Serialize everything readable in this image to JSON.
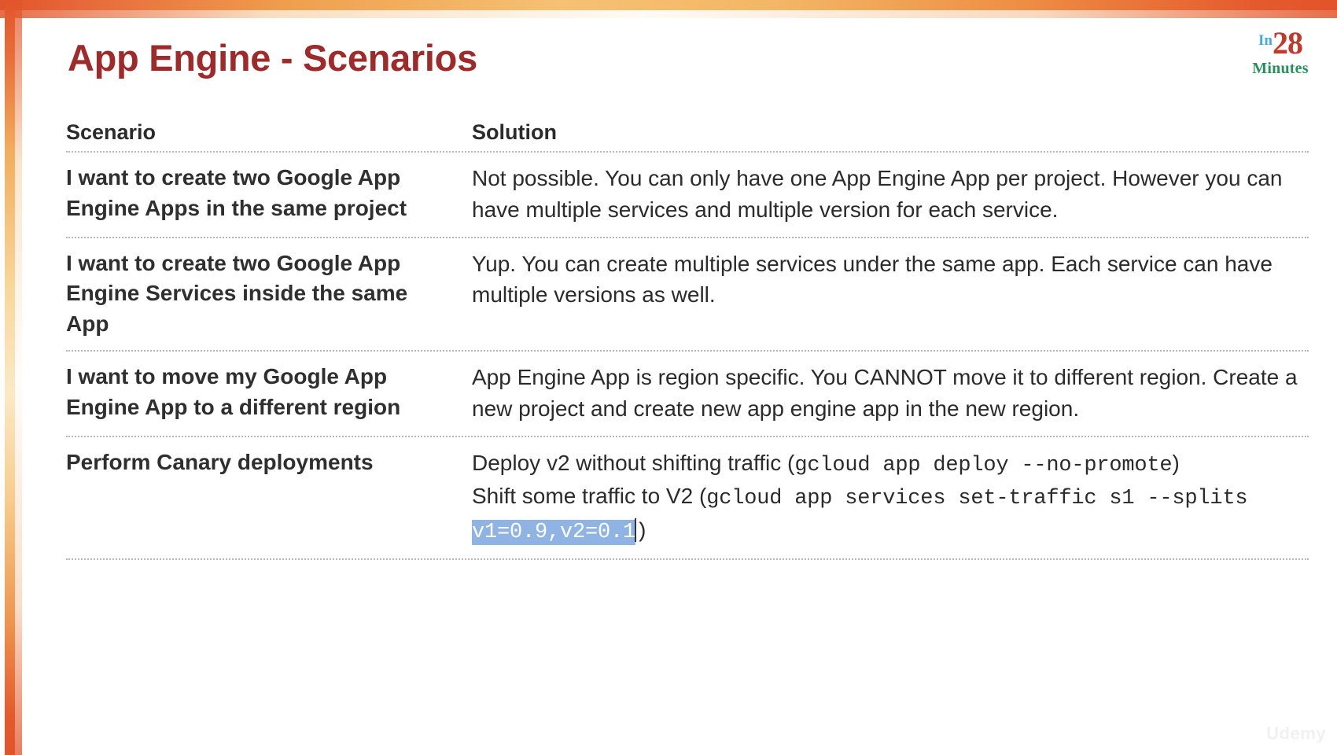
{
  "slide": {
    "title": "App Engine - Scenarios",
    "watermark": "Udemy"
  },
  "logo": {
    "prefix": "In",
    "number": "28",
    "suffix": "Minutes",
    "colors": {
      "prefix": "#4aa8d8",
      "number": "#c0392b",
      "suffix": "#2a8f5f"
    }
  },
  "theme": {
    "title_color": "#9d2b2b",
    "border_accent": "#e2542a",
    "border_mid": "#fbe9c6",
    "selection_bg": "#8fb4e3",
    "selection_fg": "#ffffff",
    "rule_color": "#b9b9b9"
  },
  "table": {
    "headers": {
      "scenario": "Scenario",
      "solution": "Solution"
    },
    "rows": [
      {
        "scenario": "I want to create two Google App Engine Apps in the same project",
        "solution": "Not possible. You can only have one App Engine App per project. However you can have multiple services and multiple version for each service."
      },
      {
        "scenario": "I want to create two Google App Engine Services inside the same App",
        "solution": "Yup. You can create multiple services under the same app. Each service can have multiple versions as well."
      },
      {
        "scenario": "I want to move my Google App Engine App to a different region",
        "solution": "App Engine App is region specific. You CANNOT move it to different region. Create a new project and create new app engine app in the new region."
      }
    ],
    "canary_row": {
      "scenario": "Perform Canary deployments",
      "line1_prefix": "Deploy v2 without shifting traffic (",
      "line1_code": "gcloud app deploy --no-promote",
      "line1_suffix": ")",
      "line2_prefix": "Shift some traffic to V2 (",
      "line2_code": "gcloud app services set-traffic s1 --splits ",
      "line2_selected": "v1=0.9,v2=0.1",
      "line2_suffix": ")"
    }
  }
}
